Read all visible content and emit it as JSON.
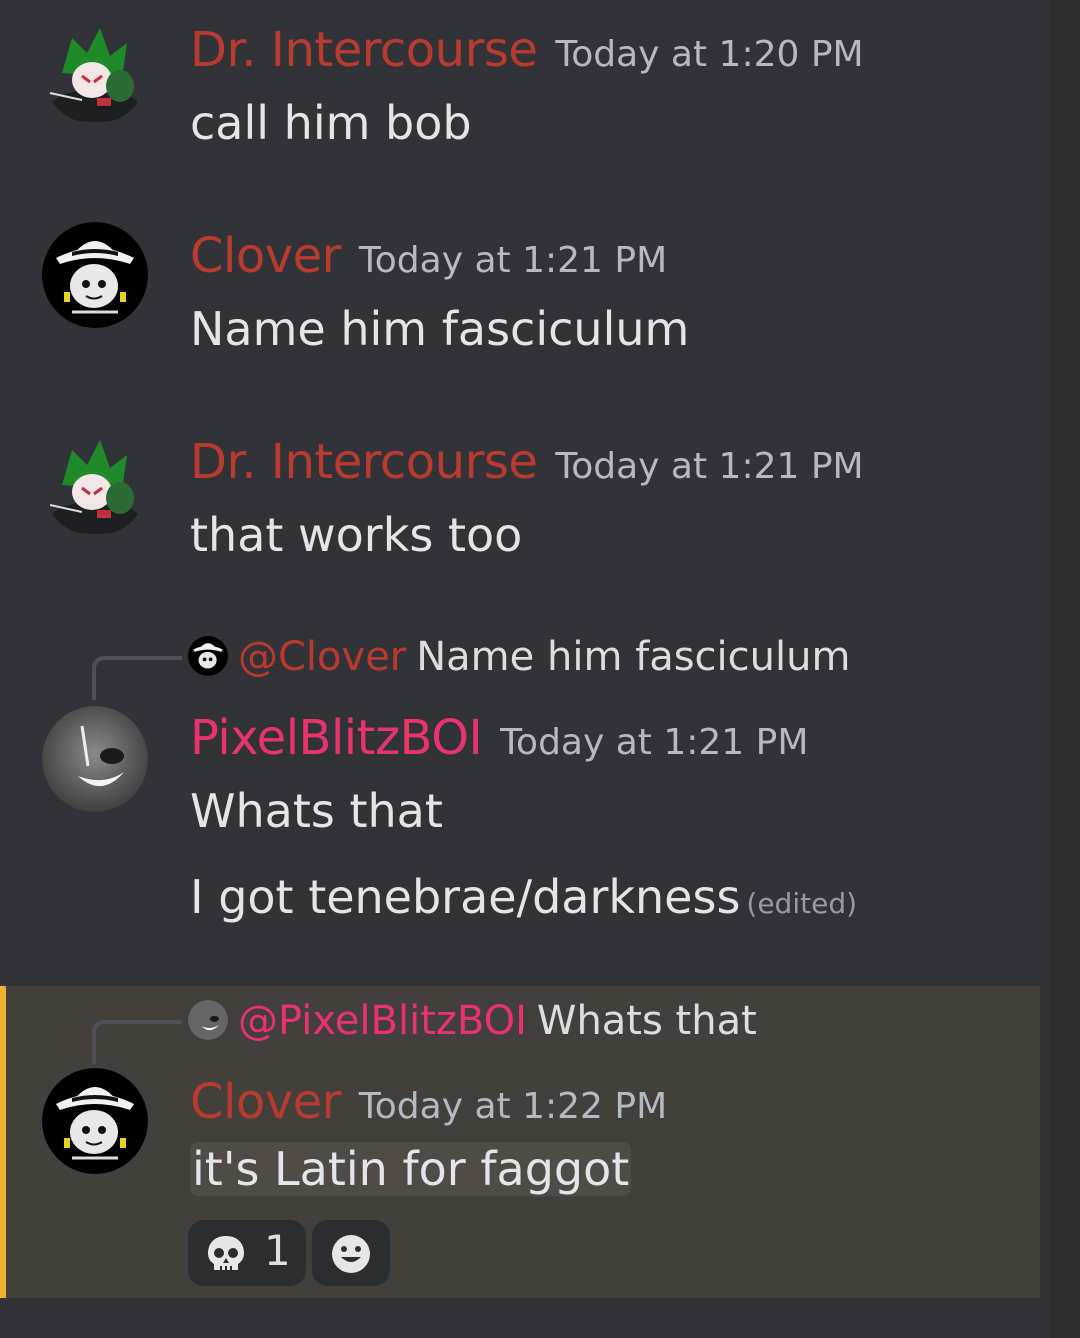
{
  "messages": [
    {
      "author": "Dr. Intercourse",
      "timestamp": "Today at 1:20 PM",
      "lines": [
        "call him bob"
      ],
      "avatar": "green-hair-avatar"
    },
    {
      "author": "Clover",
      "timestamp": "Today at 1:21 PM",
      "lines": [
        "Name him fasciculum"
      ],
      "avatar": "white-hat-avatar"
    },
    {
      "author": "Dr. Intercourse",
      "timestamp": "Today at 1:21 PM",
      "lines": [
        "that works too"
      ],
      "avatar": "green-hair-avatar"
    },
    {
      "reply": {
        "mention": "@Clover",
        "text": "Name him fasciculum"
      },
      "author": "PixelBlitzBOI",
      "timestamp": "Today at 1:21 PM",
      "lines": [
        "Whats that",
        "I got tenebrae/darkness"
      ],
      "edited": "(edited)",
      "avatar": "grey-grin-avatar"
    },
    {
      "reply": {
        "mention": "@PixelBlitzBOI",
        "text": "Whats that"
      },
      "author": "Clover",
      "timestamp": "Today at 1:22 PM",
      "lines": [
        "it's Latin for faggot"
      ],
      "avatar": "white-hat-avatar",
      "highlighted": true,
      "reactions": [
        {
          "emoji": "skull-icon",
          "count": "1"
        },
        {
          "emoji": "add-reaction-icon",
          "count": ""
        }
      ]
    }
  ],
  "colors": {
    "background": "#313338",
    "author_red": "#b93b2f",
    "author_pink": "#e8336c",
    "highlight_bg": "#433f3a",
    "highlight_bar": "#f0b232"
  }
}
